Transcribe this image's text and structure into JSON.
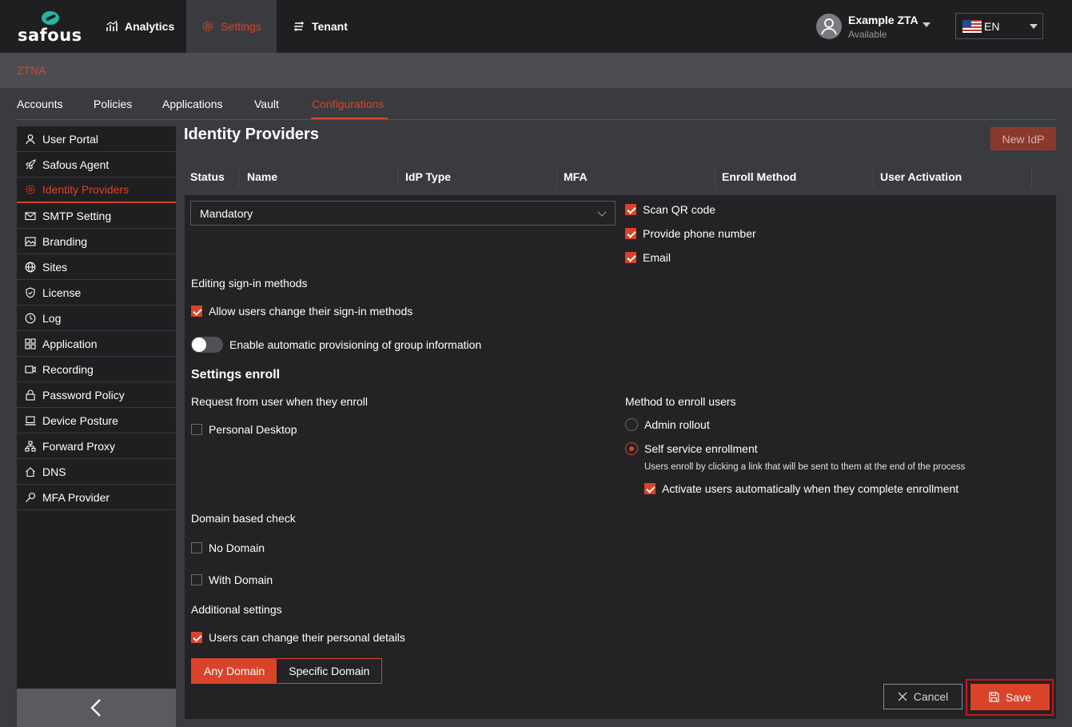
{
  "brand": {
    "logo_text": "safous",
    "accent": "#d9432a",
    "logo_color": "#1fb9a1"
  },
  "topnav": {
    "analytics": "Analytics",
    "settings": "Settings",
    "tenant": "Tenant"
  },
  "user": {
    "name": "Example ZTA",
    "status": "Available"
  },
  "language": {
    "selected": "EN"
  },
  "section_bar": {
    "label": "ZTNA"
  },
  "subtabs": [
    "Accounts",
    "Policies",
    "Applications",
    "Vault",
    "Configurations"
  ],
  "sidebar": {
    "items": [
      {
        "label": "User Portal",
        "icon": "user-icon"
      },
      {
        "label": "Safous Agent",
        "icon": "rocket-icon"
      },
      {
        "label": "Identity Providers",
        "icon": "gear-icon"
      },
      {
        "label": "SMTP Setting",
        "icon": "mail-icon"
      },
      {
        "label": "Branding",
        "icon": "image-icon"
      },
      {
        "label": "Sites",
        "icon": "globe-icon"
      },
      {
        "label": "License",
        "icon": "shield-icon"
      },
      {
        "label": "Log",
        "icon": "clock-icon"
      },
      {
        "label": "Application",
        "icon": "grid-icon"
      },
      {
        "label": "Recording",
        "icon": "video-icon"
      },
      {
        "label": "Password Policy",
        "icon": "lock-icon"
      },
      {
        "label": "Device Posture",
        "icon": "laptop-icon"
      },
      {
        "label": "Forward Proxy",
        "icon": "network-icon"
      },
      {
        "label": "DNS",
        "icon": "home-icon"
      },
      {
        "label": "MFA Provider",
        "icon": "key-icon"
      }
    ]
  },
  "main": {
    "title": "Identity Providers",
    "new_idp_label": "New IdP",
    "columns": [
      "Status",
      "Name",
      "IdP Type",
      "MFA",
      "Enroll Method",
      "User Activation"
    ],
    "mfa_select": {
      "value": "Mandatory"
    },
    "mfa_options": {
      "scan_qr": "Scan QR code",
      "phone": "Provide phone number",
      "email": "Email"
    },
    "editing_title": "Editing sign-in methods",
    "allow_change_label": "Allow users change their sign-in methods",
    "auto_provision_label": "Enable automatic provisioning of group information",
    "settings_enroll_title": "Settings enroll",
    "request_title": "Request from user when they enroll",
    "personal_desktop_label": "Personal Desktop",
    "method_title": "Method to enroll users",
    "admin_rollout_label": "Admin rollout",
    "self_service_label": "Self service enrollment",
    "self_service_hint": "Users enroll by clicking a link that will be sent to them at the end of the process",
    "activate_label": "Activate users automatically when they complete enrollment",
    "domain_check_title": "Domain based check",
    "no_domain_label": "No Domain",
    "with_domain_label": "With Domain",
    "additional_title": "Additional settings",
    "personal_details_label": "Users can change their personal details",
    "any_domain_label": "Any Domain",
    "specific_domain_label": "Specific Domain",
    "cancel_label": "Cancel",
    "save_label": "Save"
  }
}
